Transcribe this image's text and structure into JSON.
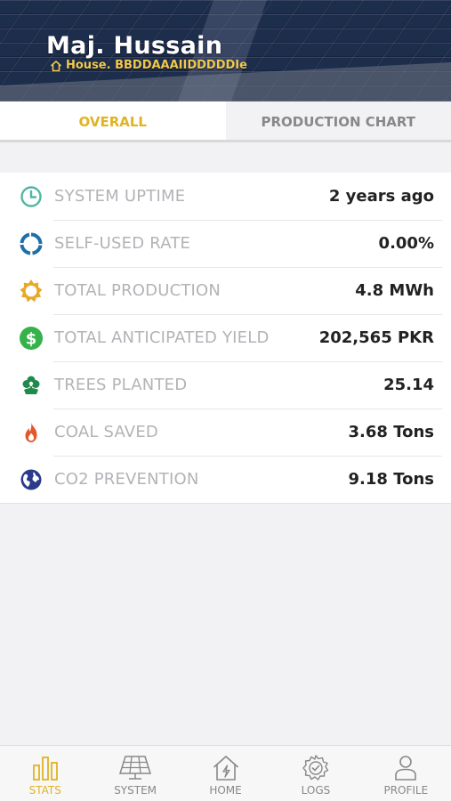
{
  "header": {
    "user_name": "Maj. Hussain",
    "address": "House. BBDDAAAIIDDDDDIe"
  },
  "tabs": [
    {
      "label": "OVERALL",
      "active": true
    },
    {
      "label": "PRODUCTION CHART",
      "active": false
    }
  ],
  "stats": [
    {
      "label": "SYSTEM UPTIME",
      "value": "2 years ago",
      "icon": "clock-icon",
      "color": "#4fb7a0"
    },
    {
      "label": "SELF-USED RATE",
      "value": "0.00%",
      "icon": "ring-icon",
      "color": "#1f6fa8"
    },
    {
      "label": "TOTAL PRODUCTION",
      "value": "4.8 MWh",
      "icon": "sun-icon",
      "color": "#e8a928"
    },
    {
      "label": "TOTAL ANTICIPATED YIELD",
      "value": "202,565 PKR",
      "icon": "dollar-icon",
      "color": "#36b24a"
    },
    {
      "label": "TREES PLANTED",
      "value": "25.14",
      "icon": "tree-icon",
      "color": "#1f8a4c"
    },
    {
      "label": "COAL SAVED",
      "value": "3.68 Tons",
      "icon": "flame-icon",
      "color": "#e2582c"
    },
    {
      "label": "CO2 PREVENTION",
      "value": "9.18 Tons",
      "icon": "globe-icon",
      "color": "#2c3a8c"
    }
  ],
  "nav": [
    {
      "label": "STATS",
      "icon": "bar-chart-icon",
      "active": true
    },
    {
      "label": "SYSTEM",
      "icon": "solar-panel-icon",
      "active": false
    },
    {
      "label": "HOME",
      "icon": "home-icon",
      "active": false
    },
    {
      "label": "LOGS",
      "icon": "gear-check-icon",
      "active": false
    },
    {
      "label": "PROFILE",
      "icon": "person-icon",
      "active": false
    }
  ],
  "colors": {
    "accent": "#e0b323",
    "header_text": "#ffffff",
    "address_text": "#f2c94c"
  }
}
